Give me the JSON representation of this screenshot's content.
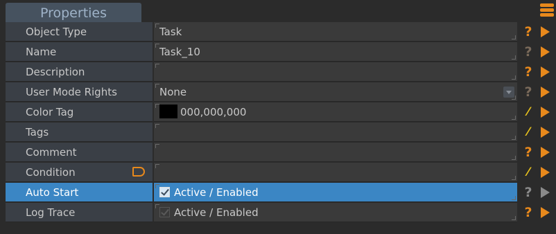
{
  "panel": {
    "tab_title": "Properties"
  },
  "rows": [
    {
      "label": "Object Type",
      "value": "Task",
      "icon1": "help-icon"
    },
    {
      "label": "Name",
      "value": "Task_10",
      "icon1": "help-icon"
    },
    {
      "label": "Description",
      "value": "",
      "icon1": "help-icon"
    },
    {
      "label": "User Mode Rights",
      "value": "None",
      "icon1": "help-icon"
    },
    {
      "label": "Color Tag",
      "value": "000,000,000",
      "swatch_color": "#000000",
      "icon1": "magic-wand-icon"
    },
    {
      "label": "Tags",
      "value": "",
      "icon1": "magic-wand-icon"
    },
    {
      "label": "Comment",
      "value": "",
      "icon1": "help-icon"
    },
    {
      "label": "Condition",
      "value": "",
      "icon1": "magic-wand-icon"
    },
    {
      "label": "Auto Start",
      "value": "Active / Enabled",
      "checked": true,
      "selected": true,
      "icon1": "help-icon"
    },
    {
      "label": "Log Trace",
      "value": "Active / Enabled",
      "checked": false,
      "icon1": "help-icon"
    }
  ],
  "colors": {
    "accent": "#e8891c",
    "selection": "#3b86c4",
    "tab": "#46525f"
  },
  "glyphs": {
    "help": "?",
    "wand": "⁄"
  }
}
